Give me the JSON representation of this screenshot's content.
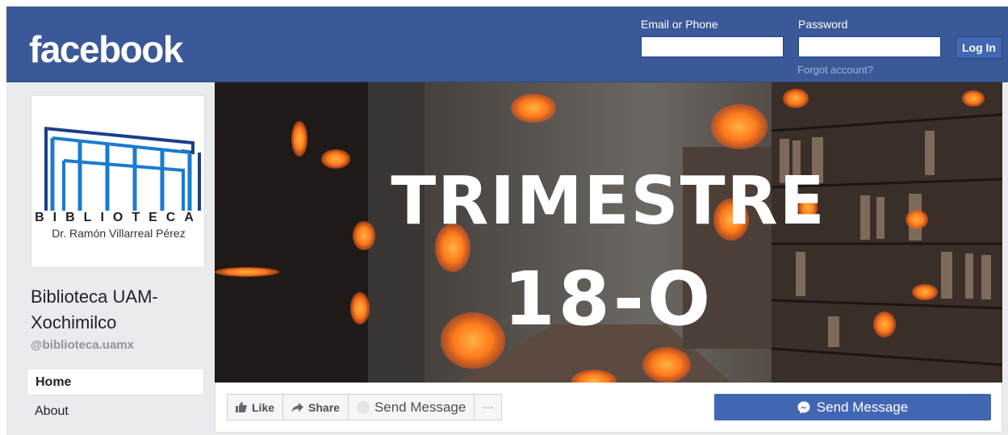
{
  "brand": {
    "logo_text": "facebook"
  },
  "login": {
    "email_label": "Email or Phone",
    "password_label": "Password",
    "login_button": "Log In",
    "forgot_link": "Forgot account?"
  },
  "profile": {
    "logo_word": "BIBLIOTECA",
    "logo_subtitle": "Dr. Ramón Villarreal Pérez",
    "page_name": "Biblioteca UAM-Xochimilco",
    "handle": "@biblioteca.uamx"
  },
  "nav": {
    "items": [
      {
        "label": "Home"
      },
      {
        "label": "About"
      }
    ]
  },
  "cover": {
    "line1": "TRIMESTRE",
    "line2": "18-O"
  },
  "actions": {
    "like": "Like",
    "share": "Share",
    "send_message": "Send Message",
    "more": "···",
    "primary_send_message": "Send Message"
  },
  "colors": {
    "brand_blue": "#3b5998",
    "button_blue": "#4267b2",
    "page_bg": "#e9ebee",
    "logo_blue": "#1a7bd0"
  }
}
